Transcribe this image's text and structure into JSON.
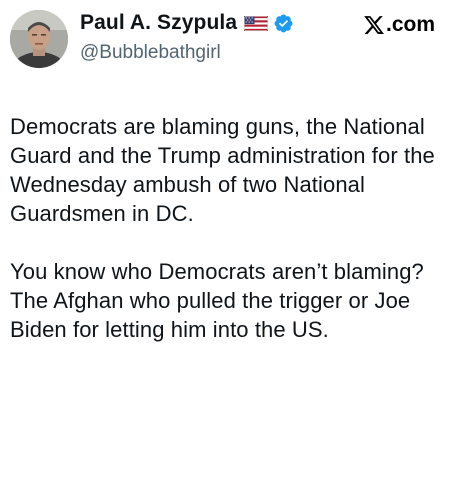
{
  "post": {
    "author": {
      "display_name": "Paul A. Szypula",
      "handle": "@Bubblebathgirl",
      "badges": [
        "us-flag-icon",
        "verified-icon"
      ]
    },
    "brand": {
      "icon": "x-logo-icon",
      "text": ".com"
    },
    "paragraphs": [
      "Democrats are blaming guns, the National Guard and the Trump administration for the Wednesday ambush of two National Guardsmen in DC.",
      "You know who Democrats aren’t blaming? The Afghan who pulled the trigger or Joe Biden for letting him into the US."
    ]
  },
  "colors": {
    "text": "#0f1419",
    "handle": "#536471",
    "verified": "#1d9bf0",
    "flag_red": "#b22234",
    "flag_blue": "#3c3b6e"
  }
}
